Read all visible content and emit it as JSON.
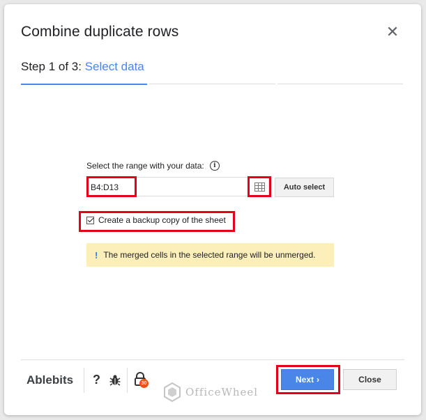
{
  "dialog": {
    "title": "Combine duplicate rows",
    "close_icon": "close-icon"
  },
  "step": {
    "prefix": "Step 1 of 3:",
    "name": "Select data",
    "current": 1,
    "total": 3
  },
  "range": {
    "label": "Select the range with your data:",
    "info_icon": "info-icon",
    "value": "B4:D13",
    "grid_icon": "table-grid-icon",
    "auto_select_label": "Auto select"
  },
  "backup": {
    "label": "Create a backup copy of the sheet",
    "checked": true
  },
  "notice": {
    "icon": "!",
    "text": "The merged cells in the selected range will be unmerged."
  },
  "footer": {
    "brand": "Ablebits",
    "help_label": "?",
    "bug_icon": "bug-icon",
    "lock_icon": "lock-icon",
    "badge": "30",
    "watermark": "OfficeWheel",
    "next_label": "Next",
    "next_chevron": "›",
    "close_label": "Close"
  },
  "colors": {
    "accent": "#4a86e8",
    "highlight": "#e2001a",
    "notice_bg": "#fcefb9"
  }
}
